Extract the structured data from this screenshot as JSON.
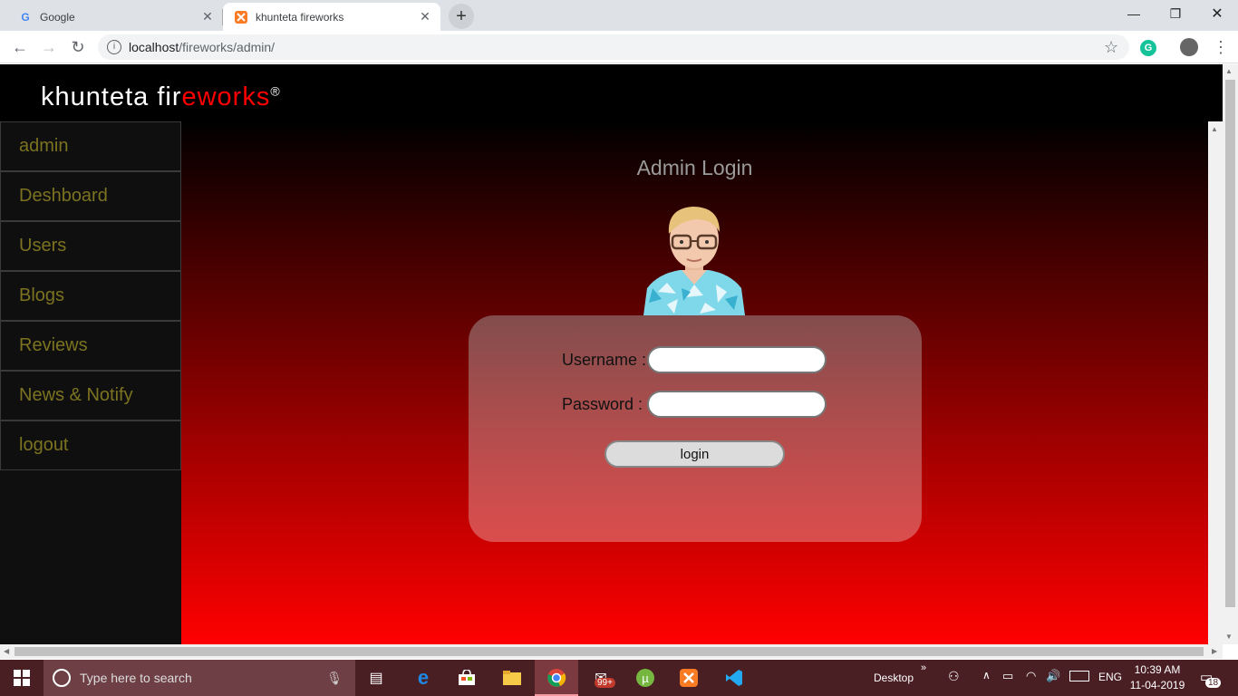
{
  "browser": {
    "tabs": [
      {
        "title": "Google",
        "icon": "google-icon"
      },
      {
        "title": "khunteta fireworks",
        "icon": "xampp-icon"
      }
    ],
    "url_host": "localhost",
    "url_path": "/fireworks/admin/"
  },
  "site": {
    "logo_white": "khunteta fir",
    "logo_red": "eworks",
    "logo_mark": "®"
  },
  "sidebar": {
    "items": [
      {
        "label": "admin"
      },
      {
        "label": "Deshboard"
      },
      {
        "label": "Users"
      },
      {
        "label": "Blogs"
      },
      {
        "label": "Reviews"
      },
      {
        "label": "News & Notify"
      },
      {
        "label": "logout"
      }
    ]
  },
  "login": {
    "title": "Admin Login",
    "username_label": "Username :",
    "password_label": "Password :",
    "username_value": "",
    "password_value": "",
    "button_label": "login"
  },
  "taskbar": {
    "search_placeholder": "Type here to search",
    "desktop_label": "Desktop",
    "language": "ENG",
    "time": "10:39 AM",
    "date": "11-04-2019",
    "mail_badge": "99+",
    "notification_count": "18"
  },
  "colors": {
    "accent_red": "#ff0000",
    "sidebar_text": "#7c7320",
    "taskbar": "#4a1f24"
  }
}
